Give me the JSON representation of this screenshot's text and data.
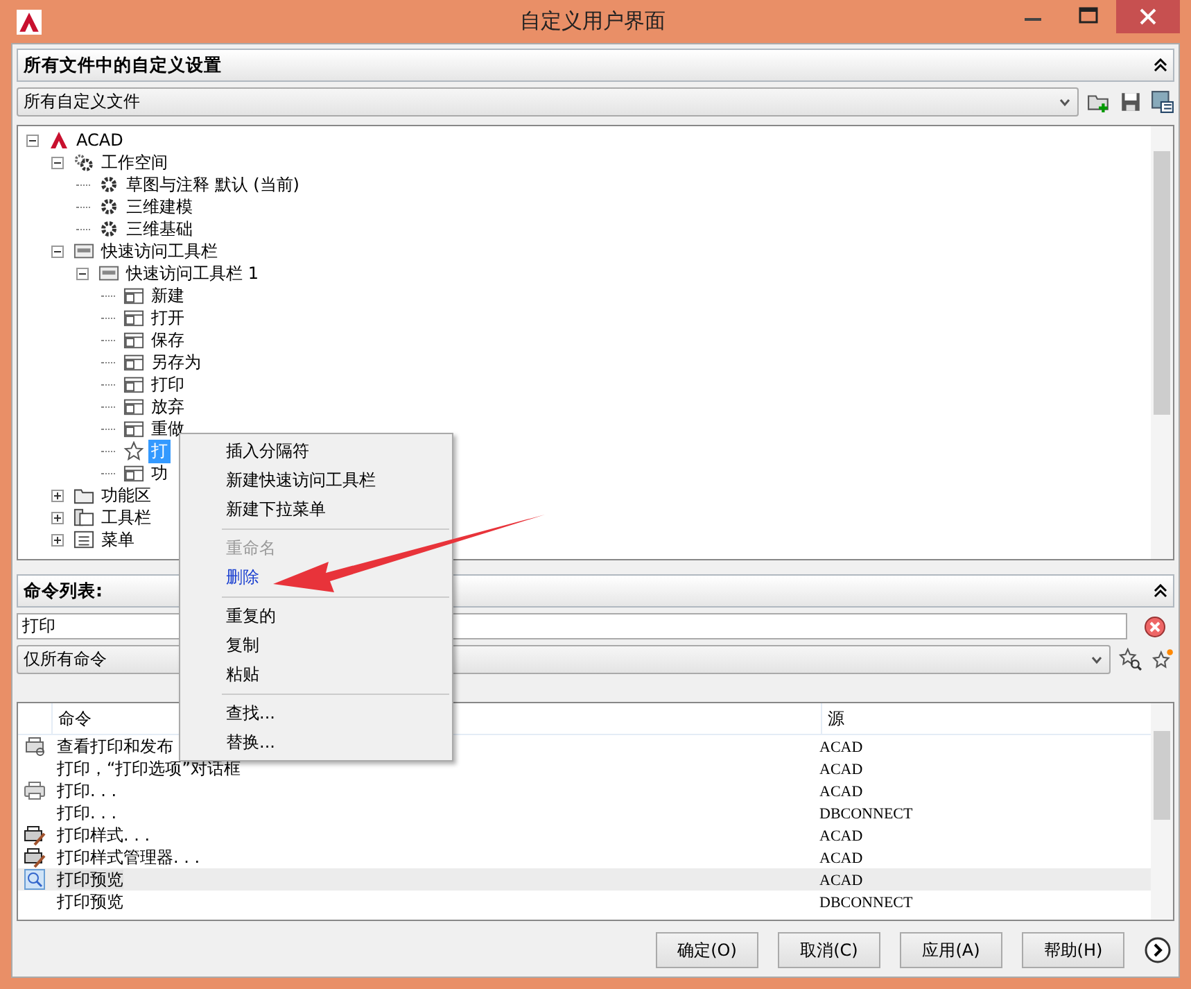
{
  "window": {
    "title": "自定义用户界面"
  },
  "customizations_panel": {
    "title": "所有文件中的自定义设置",
    "file_select": {
      "value": "所有自定义文件"
    }
  },
  "tree": {
    "items": [
      {
        "label": "ACAD",
        "kind": "acad",
        "expanded": true,
        "selected": false,
        "children": [
          {
            "label": "工作空间",
            "kind": "workspace",
            "expanded": true,
            "selected": false,
            "children": [
              {
                "label": "草图与注释 默认 (当前)",
                "kind": "gear",
                "selected": false
              },
              {
                "label": "三维建模",
                "kind": "gear",
                "selected": false
              },
              {
                "label": "三维基础",
                "kind": "gear",
                "selected": false
              }
            ]
          },
          {
            "label": "快速访问工具栏",
            "kind": "qat",
            "expanded": true,
            "selected": false,
            "children": [
              {
                "label": "快速访问工具栏 1",
                "kind": "toolbar",
                "expanded": true,
                "selected": false,
                "children": [
                  {
                    "label": "新建",
                    "kind": "button",
                    "selected": false
                  },
                  {
                    "label": "打开",
                    "kind": "button",
                    "selected": false
                  },
                  {
                    "label": "保存",
                    "kind": "button",
                    "selected": false
                  },
                  {
                    "label": "另存为",
                    "kind": "button",
                    "selected": false
                  },
                  {
                    "label": "打印",
                    "kind": "button",
                    "selected": false
                  },
                  {
                    "label": "放弃",
                    "kind": "button",
                    "selected": false
                  },
                  {
                    "label": "重做",
                    "kind": "button",
                    "selected": false
                  },
                  {
                    "label": "打",
                    "kind": "star",
                    "selected": true
                  },
                  {
                    "label": "功",
                    "kind": "button",
                    "selected": false
                  }
                ]
              }
            ]
          },
          {
            "label": "功能区",
            "kind": "folder",
            "expanded": false,
            "selected": false
          },
          {
            "label": "工具栏",
            "kind": "toolbars",
            "expanded": false,
            "selected": false
          },
          {
            "label": "菜单",
            "kind": "menu",
            "expanded": false,
            "selected": false
          }
        ]
      }
    ]
  },
  "command_panel": {
    "title": "命令列表:",
    "search": {
      "value": "打印"
    },
    "filter_select": {
      "value": "仅所有命令"
    }
  },
  "table": {
    "columns": [
      "命令",
      "源"
    ],
    "rows": [
      {
        "kind": "preview",
        "command": "查看打印和发布",
        "source": "ACAD",
        "selected": false
      },
      {
        "kind": "plain",
        "command": "打印，“打印选项”对话框",
        "source": "ACAD",
        "selected": false
      },
      {
        "kind": "printer",
        "command": "打印. . .",
        "source": "ACAD",
        "selected": false
      },
      {
        "kind": "plain",
        "command": "打印. . .",
        "source": "DBCONNECT",
        "selected": false
      },
      {
        "kind": "style",
        "command": "打印样式. . .",
        "source": "ACAD",
        "selected": false
      },
      {
        "kind": "style",
        "command": "打印样式管理器. . .",
        "source": "ACAD",
        "selected": false
      },
      {
        "kind": "zoom",
        "command": "打印预览",
        "source": "ACAD",
        "selected": true
      },
      {
        "kind": "plain",
        "command": "打印预览",
        "source": "DBCONNECT",
        "selected": false
      }
    ]
  },
  "buttons": [
    "确定(O)",
    "取消(C)",
    "应用(A)",
    "帮助(H)"
  ],
  "context_menu": {
    "items": [
      {
        "kind": "item",
        "label": "插入分隔符",
        "disabled": false,
        "highlighted": false
      },
      {
        "kind": "item",
        "label": "新建快速访问工具栏",
        "disabled": false,
        "highlighted": false
      },
      {
        "kind": "item",
        "label": "新建下拉菜单",
        "disabled": false,
        "highlighted": false
      },
      {
        "kind": "separator"
      },
      {
        "kind": "item",
        "label": "重命名",
        "disabled": true,
        "highlighted": false
      },
      {
        "kind": "item",
        "label": "删除",
        "disabled": false,
        "highlighted": true
      },
      {
        "kind": "separator"
      },
      {
        "kind": "item",
        "label": "重复的",
        "disabled": false,
        "highlighted": false
      },
      {
        "kind": "item",
        "label": "复制",
        "disabled": false,
        "highlighted": false
      },
      {
        "kind": "item",
        "label": "粘贴",
        "disabled": false,
        "highlighted": false
      },
      {
        "kind": "separator"
      },
      {
        "kind": "item",
        "label": "查找...",
        "disabled": false,
        "highlighted": false
      },
      {
        "kind": "item",
        "label": "替换...",
        "disabled": false,
        "highlighted": false
      }
    ]
  }
}
